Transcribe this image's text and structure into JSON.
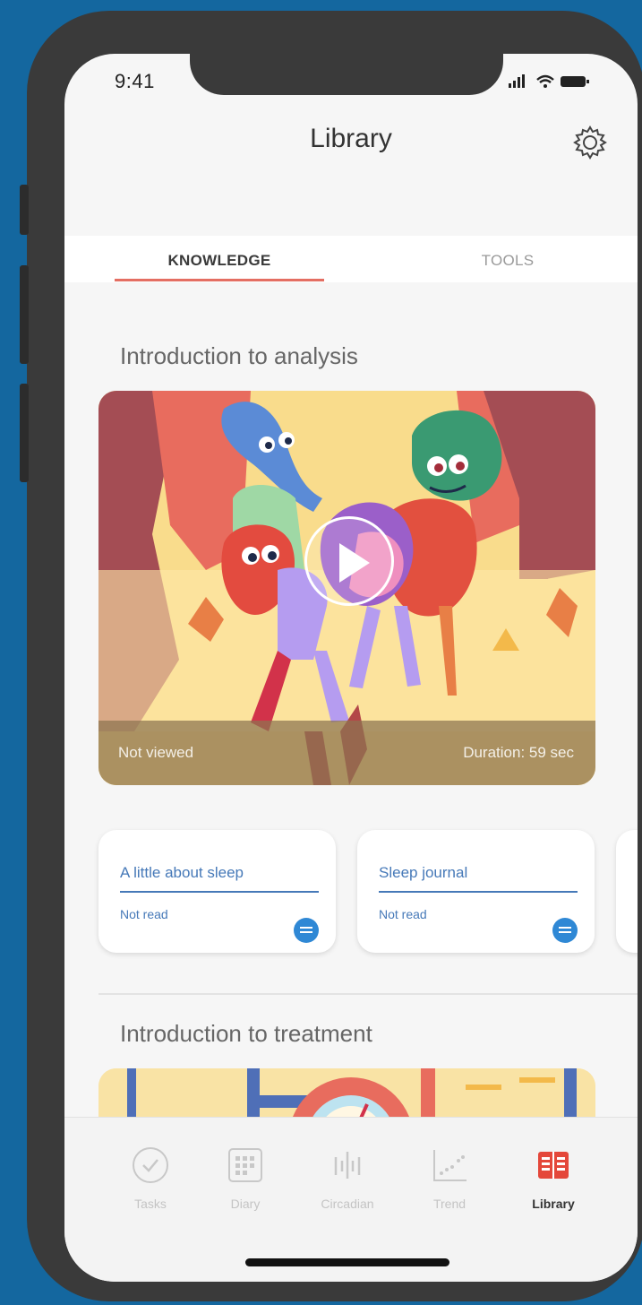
{
  "status_bar": {
    "time": "9:41"
  },
  "header": {
    "title": "Library",
    "settings_icon": "gear-icon"
  },
  "tabs": [
    {
      "label": "KNOWLEDGE",
      "active": true
    },
    {
      "label": "TOOLS",
      "active": false
    }
  ],
  "sections": [
    {
      "title": "Introduction to analysis",
      "video": {
        "status": "Not viewed",
        "duration": "Duration: 59 sec"
      },
      "articles": [
        {
          "title": "A little about sleep",
          "status": "Not read",
          "icon": "document-icon"
        },
        {
          "title": "Sleep journal",
          "status": "Not read",
          "icon": "document-icon"
        }
      ]
    },
    {
      "title": "Introduction to treatment"
    }
  ],
  "bottom_nav": {
    "items": [
      {
        "label": "Tasks",
        "icon": "check-circle-icon",
        "active": false
      },
      {
        "label": "Diary",
        "icon": "calendar-icon",
        "active": false
      },
      {
        "label": "Circadian",
        "icon": "circadian-icon",
        "active": false
      },
      {
        "label": "Trend",
        "icon": "trend-chart-icon",
        "active": false
      },
      {
        "label": "Library",
        "icon": "library-book-icon",
        "active": true
      }
    ]
  },
  "colors": {
    "background": "#14679f",
    "accent": "#e46e62",
    "link_blue": "#4679b8",
    "icon_blue": "#2f88d5"
  }
}
